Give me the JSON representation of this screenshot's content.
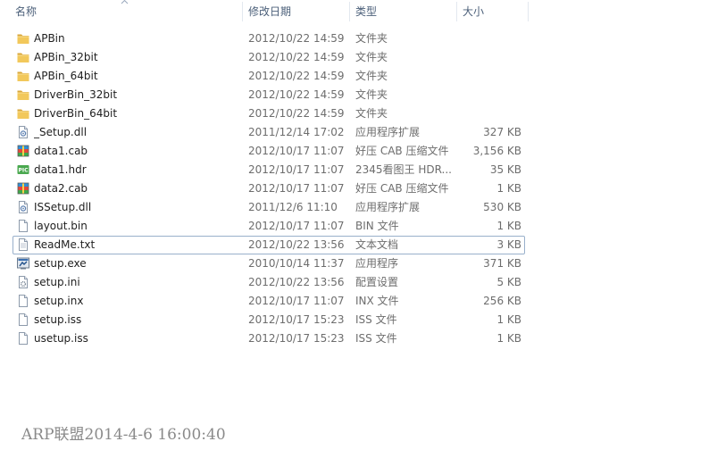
{
  "columns": {
    "name": "名称",
    "date": "修改日期",
    "type": "类型",
    "size": "大小"
  },
  "files": [
    {
      "name": "APBin",
      "date": "2012/10/22 14:59",
      "type": "文件夹",
      "size": "",
      "icon": "folder-icon"
    },
    {
      "name": "APBin_32bit",
      "date": "2012/10/22 14:59",
      "type": "文件夹",
      "size": "",
      "icon": "folder-icon"
    },
    {
      "name": "APBin_64bit",
      "date": "2012/10/22 14:59",
      "type": "文件夹",
      "size": "",
      "icon": "folder-icon"
    },
    {
      "name": "DriverBin_32bit",
      "date": "2012/10/22 14:59",
      "type": "文件夹",
      "size": "",
      "icon": "folder-icon"
    },
    {
      "name": "DriverBin_64bit",
      "date": "2012/10/22 14:59",
      "type": "文件夹",
      "size": "",
      "icon": "folder-icon"
    },
    {
      "name": "_Setup.dll",
      "date": "2011/12/14 17:02",
      "type": "应用程序扩展",
      "size": "327 KB",
      "icon": "dll-file-icon"
    },
    {
      "name": "data1.cab",
      "date": "2012/10/17 11:07",
      "type": "好压 CAB 压缩文件",
      "size": "3,156 KB",
      "icon": "archive-file-icon"
    },
    {
      "name": "data1.hdr",
      "date": "2012/10/17 11:07",
      "type": "2345看图王 HDR...",
      "size": "35 KB",
      "icon": "image-file-icon"
    },
    {
      "name": "data2.cab",
      "date": "2012/10/17 11:07",
      "type": "好压 CAB 压缩文件",
      "size": "1 KB",
      "icon": "archive-file-icon"
    },
    {
      "name": "ISSetup.dll",
      "date": "2011/12/6 11:10",
      "type": "应用程序扩展",
      "size": "530 KB",
      "icon": "dll-file-icon"
    },
    {
      "name": "layout.bin",
      "date": "2012/10/17 11:07",
      "type": "BIN 文件",
      "size": "1 KB",
      "icon": "blank-file-icon"
    },
    {
      "name": "ReadMe.txt",
      "date": "2012/10/22 13:56",
      "type": "文本文档",
      "size": "3 KB",
      "icon": "text-file-icon"
    },
    {
      "name": "setup.exe",
      "date": "2010/10/14 11:37",
      "type": "应用程序",
      "size": "371 KB",
      "icon": "exe-file-icon"
    },
    {
      "name": "setup.ini",
      "date": "2012/10/22 13:56",
      "type": "配置设置",
      "size": "5 KB",
      "icon": "ini-file-icon"
    },
    {
      "name": "setup.inx",
      "date": "2012/10/17 11:07",
      "type": "INX 文件",
      "size": "256 KB",
      "icon": "blank-file-icon"
    },
    {
      "name": "setup.iss",
      "date": "2012/10/17 15:23",
      "type": "ISS 文件",
      "size": "1 KB",
      "icon": "blank-file-icon"
    },
    {
      "name": "usetup.iss",
      "date": "2012/10/17 15:23",
      "type": "ISS 文件",
      "size": "1 KB",
      "icon": "blank-file-icon"
    }
  ],
  "focused_index": 11,
  "watermark": "ARP联盟2014-4-6 16:00:40",
  "colors": {
    "header_text": "#4c607a",
    "name_text": "#1e1e1e",
    "detail_text": "#6d6d6d",
    "focus_border": "#99b0cb",
    "folder": "#e8b84a"
  }
}
